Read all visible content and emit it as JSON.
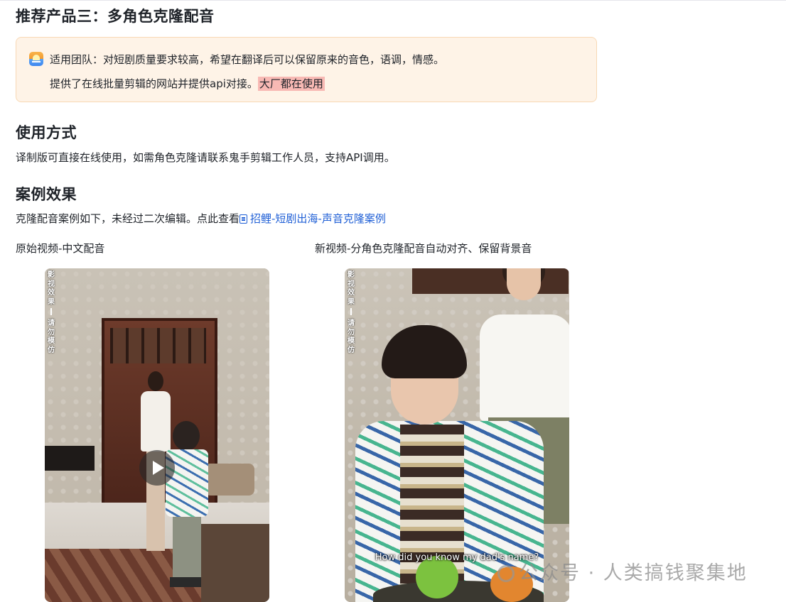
{
  "section_title": "推荐产品三：多角色克隆配音",
  "callout": {
    "line1": "适用团队：对短剧质量要求较高，希望在翻译后可以保留原来的音色，语调，情感。",
    "line2_prefix": "提供了在线批量剪辑的网站并提供api对接。",
    "line2_highlight": "大厂都在使用",
    "icon": "sunrise-icon"
  },
  "usage": {
    "heading": "使用方式",
    "text": "译制版可直接在线使用，如需角色克隆请联系鬼手剪辑工作人员，支持API调用。"
  },
  "cases": {
    "heading": "案例效果",
    "text_prefix": "克隆配音案例如下，未经过二次编辑。点此查看",
    "link_text": "招鲤-短剧出海-声音克隆案例",
    "link_icon": "doc-icon"
  },
  "videos": [
    {
      "caption": "原始视频-中文配音",
      "overlay_top": "影视效果",
      "overlay_bottom": "请勿模仿",
      "subtitle": ""
    },
    {
      "caption": "新视频-分角色克隆配音自动对齐、保留背景音",
      "overlay_top": "影视效果",
      "overlay_bottom": "请勿模仿",
      "subtitle": "How did you know my dad's name?"
    }
  ],
  "watermark": "公众号 · 人类搞钱聚集地",
  "colors": {
    "callout_bg": "#fef3e7",
    "callout_border": "#f8d8b4",
    "highlight": "#f8b9b4",
    "link": "#1f5fd6"
  }
}
